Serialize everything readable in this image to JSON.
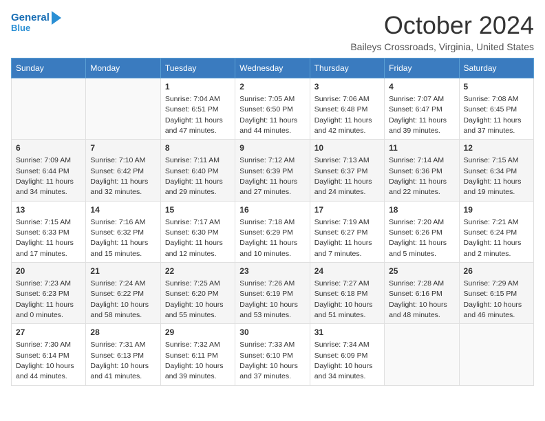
{
  "header": {
    "logo_line1": "General",
    "logo_line2": "Blue",
    "month": "October 2024",
    "location": "Baileys Crossroads, Virginia, United States"
  },
  "days_of_week": [
    "Sunday",
    "Monday",
    "Tuesday",
    "Wednesday",
    "Thursday",
    "Friday",
    "Saturday"
  ],
  "weeks": [
    [
      {
        "day": "",
        "content": ""
      },
      {
        "day": "",
        "content": ""
      },
      {
        "day": "1",
        "content": "Sunrise: 7:04 AM\nSunset: 6:51 PM\nDaylight: 11 hours and 47 minutes."
      },
      {
        "day": "2",
        "content": "Sunrise: 7:05 AM\nSunset: 6:50 PM\nDaylight: 11 hours and 44 minutes."
      },
      {
        "day": "3",
        "content": "Sunrise: 7:06 AM\nSunset: 6:48 PM\nDaylight: 11 hours and 42 minutes."
      },
      {
        "day": "4",
        "content": "Sunrise: 7:07 AM\nSunset: 6:47 PM\nDaylight: 11 hours and 39 minutes."
      },
      {
        "day": "5",
        "content": "Sunrise: 7:08 AM\nSunset: 6:45 PM\nDaylight: 11 hours and 37 minutes."
      }
    ],
    [
      {
        "day": "6",
        "content": "Sunrise: 7:09 AM\nSunset: 6:44 PM\nDaylight: 11 hours and 34 minutes."
      },
      {
        "day": "7",
        "content": "Sunrise: 7:10 AM\nSunset: 6:42 PM\nDaylight: 11 hours and 32 minutes."
      },
      {
        "day": "8",
        "content": "Sunrise: 7:11 AM\nSunset: 6:40 PM\nDaylight: 11 hours and 29 minutes."
      },
      {
        "day": "9",
        "content": "Sunrise: 7:12 AM\nSunset: 6:39 PM\nDaylight: 11 hours and 27 minutes."
      },
      {
        "day": "10",
        "content": "Sunrise: 7:13 AM\nSunset: 6:37 PM\nDaylight: 11 hours and 24 minutes."
      },
      {
        "day": "11",
        "content": "Sunrise: 7:14 AM\nSunset: 6:36 PM\nDaylight: 11 hours and 22 minutes."
      },
      {
        "day": "12",
        "content": "Sunrise: 7:15 AM\nSunset: 6:34 PM\nDaylight: 11 hours and 19 minutes."
      }
    ],
    [
      {
        "day": "13",
        "content": "Sunrise: 7:15 AM\nSunset: 6:33 PM\nDaylight: 11 hours and 17 minutes."
      },
      {
        "day": "14",
        "content": "Sunrise: 7:16 AM\nSunset: 6:32 PM\nDaylight: 11 hours and 15 minutes."
      },
      {
        "day": "15",
        "content": "Sunrise: 7:17 AM\nSunset: 6:30 PM\nDaylight: 11 hours and 12 minutes."
      },
      {
        "day": "16",
        "content": "Sunrise: 7:18 AM\nSunset: 6:29 PM\nDaylight: 11 hours and 10 minutes."
      },
      {
        "day": "17",
        "content": "Sunrise: 7:19 AM\nSunset: 6:27 PM\nDaylight: 11 hours and 7 minutes."
      },
      {
        "day": "18",
        "content": "Sunrise: 7:20 AM\nSunset: 6:26 PM\nDaylight: 11 hours and 5 minutes."
      },
      {
        "day": "19",
        "content": "Sunrise: 7:21 AM\nSunset: 6:24 PM\nDaylight: 11 hours and 2 minutes."
      }
    ],
    [
      {
        "day": "20",
        "content": "Sunrise: 7:23 AM\nSunset: 6:23 PM\nDaylight: 11 hours and 0 minutes."
      },
      {
        "day": "21",
        "content": "Sunrise: 7:24 AM\nSunset: 6:22 PM\nDaylight: 10 hours and 58 minutes."
      },
      {
        "day": "22",
        "content": "Sunrise: 7:25 AM\nSunset: 6:20 PM\nDaylight: 10 hours and 55 minutes."
      },
      {
        "day": "23",
        "content": "Sunrise: 7:26 AM\nSunset: 6:19 PM\nDaylight: 10 hours and 53 minutes."
      },
      {
        "day": "24",
        "content": "Sunrise: 7:27 AM\nSunset: 6:18 PM\nDaylight: 10 hours and 51 minutes."
      },
      {
        "day": "25",
        "content": "Sunrise: 7:28 AM\nSunset: 6:16 PM\nDaylight: 10 hours and 48 minutes."
      },
      {
        "day": "26",
        "content": "Sunrise: 7:29 AM\nSunset: 6:15 PM\nDaylight: 10 hours and 46 minutes."
      }
    ],
    [
      {
        "day": "27",
        "content": "Sunrise: 7:30 AM\nSunset: 6:14 PM\nDaylight: 10 hours and 44 minutes."
      },
      {
        "day": "28",
        "content": "Sunrise: 7:31 AM\nSunset: 6:13 PM\nDaylight: 10 hours and 41 minutes."
      },
      {
        "day": "29",
        "content": "Sunrise: 7:32 AM\nSunset: 6:11 PM\nDaylight: 10 hours and 39 minutes."
      },
      {
        "day": "30",
        "content": "Sunrise: 7:33 AM\nSunset: 6:10 PM\nDaylight: 10 hours and 37 minutes."
      },
      {
        "day": "31",
        "content": "Sunrise: 7:34 AM\nSunset: 6:09 PM\nDaylight: 10 hours and 34 minutes."
      },
      {
        "day": "",
        "content": ""
      },
      {
        "day": "",
        "content": ""
      }
    ]
  ]
}
